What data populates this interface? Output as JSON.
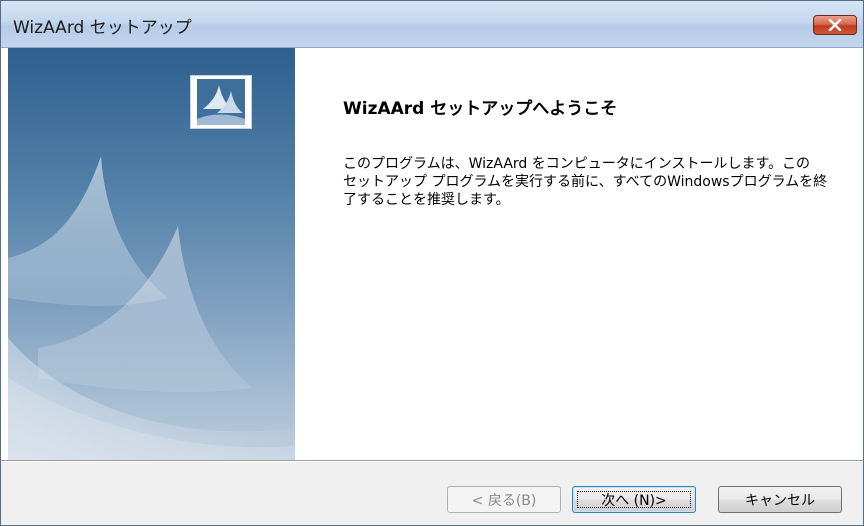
{
  "window": {
    "title": "WizAArd セットアップ",
    "close_icon": "close-icon"
  },
  "banner": {
    "icon": "setup-wizard-icon"
  },
  "content": {
    "heading": "WizAArd セットアップへようこそ",
    "body_lines": [
      "このプログラムは、WizAArd をコンピュータにインストールします。この",
      "セットアップ プログラムを実行する前に、すべてのWindowsプログラムを終",
      "了することを推奨します。"
    ]
  },
  "buttons": {
    "back": "< 戻る(B)",
    "next": "次へ (N)>",
    "cancel": "キャンセル"
  },
  "colors": {
    "titlebar": "#c4d7ee",
    "close_button": "#c13a1c",
    "banner_top": "#2f5f8e",
    "banner_bottom": "#bccbdc",
    "footer": "#f0f0f0"
  }
}
